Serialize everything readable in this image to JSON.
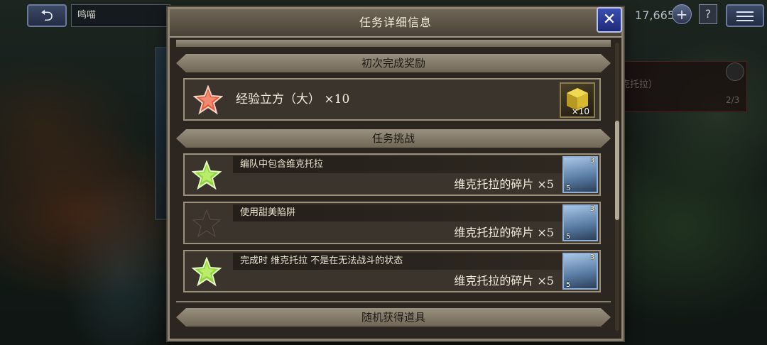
{
  "topbar": {
    "back_icon": "back-arrow-icon",
    "screen_title": "鸣喵",
    "gem_count": "17,665",
    "add_label": "+",
    "help_label": "?",
    "menu_icon": "hamburger-menu-icon"
  },
  "background": {
    "item_text": "克托拉）",
    "item_count": "2/3"
  },
  "modal": {
    "title": "任务详细信息",
    "close_label": "✕",
    "first_clear": {
      "section_label": "初次完成奖励",
      "reward_text": "经验立方（大） ×10",
      "item_qty": "×10",
      "star_color": "#e05a3c"
    },
    "challenges": {
      "section_label": "任务挑战",
      "items": [
        {
          "description": "编队中包含维克托拉",
          "reward": "维克托拉的碎片 ×5",
          "completed": true,
          "portrait_rank": "3",
          "portrait_count": "5"
        },
        {
          "description": "使用甜美陷阱",
          "reward": "维克托拉的碎片 ×5",
          "completed": false,
          "portrait_rank": "3",
          "portrait_count": "5"
        },
        {
          "description": "完成时 维克托拉 不是在无法战斗的状态",
          "reward": "维克托拉的碎片 ×5",
          "completed": true,
          "portrait_rank": "3",
          "portrait_count": "5"
        }
      ]
    },
    "random_drops": {
      "section_label": "随机获得道具"
    }
  },
  "colors": {
    "star_complete": "#8fd43a",
    "star_incomplete": "#3a332b",
    "star_reward": "#e05a3c"
  }
}
